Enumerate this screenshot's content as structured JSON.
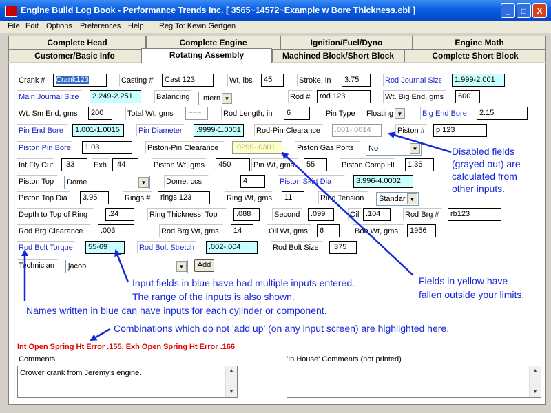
{
  "window": {
    "title": "Engine Build Log Book - Performance Trends Inc.   [ 3565~14572~Example w Bore Thickness.ebl ]",
    "buttons": {
      "minimize": "_",
      "maximize": "□",
      "close": "X"
    }
  },
  "menu": {
    "items": [
      "File",
      "Edit",
      "Options",
      "Preferences",
      "Help"
    ],
    "reg_to": "Reg To: Kevin Gertgen"
  },
  "tabs": {
    "row1": [
      "Complete Head",
      "Complete Engine",
      "Ignition/Fuel/Dyno",
      "Engine Math"
    ],
    "row2": [
      "Customer/Basic Info",
      "Rotating Assembly",
      "Machined Block/Short Block",
      "Complete Short Block"
    ]
  },
  "fields": {
    "crank_no": {
      "label": "Crank #",
      "value": "Crank123"
    },
    "casting_no": {
      "label": "Casting #",
      "value": "Cast 123"
    },
    "wt_lbs": {
      "label": "Wt, lbs",
      "value": "45"
    },
    "stroke": {
      "label": "Stroke, in",
      "value": "3.75"
    },
    "rod_journal": {
      "label": "Rod Journal Size",
      "value": "1.999-2.001"
    },
    "main_journal": {
      "label": "Main Journal Size",
      "value": "2.249-2.251"
    },
    "balancing": {
      "label": "Balancing",
      "value": "Intern"
    },
    "rod_no": {
      "label": "Rod #",
      "value": "rod 123"
    },
    "wt_big_end": {
      "label": "Wt. Big End, gms",
      "value": "600"
    },
    "wt_sm_end": {
      "label": "Wt. Sm End, gms",
      "value": "200"
    },
    "total_wt": {
      "label": "Total Wt, gms",
      "value": "~~~"
    },
    "rod_length": {
      "label": "Rod Length, in",
      "value": "6"
    },
    "pin_type": {
      "label": "Pin Type",
      "value": "Floating"
    },
    "big_end_bore": {
      "label": "Big End Bore",
      "value": "2.15"
    },
    "pin_end_bore": {
      "label": "Pin End Bore",
      "value": "1.001-1.0015"
    },
    "pin_diameter": {
      "label": "Pin Diameter",
      "value": ".9999-1.0001"
    },
    "rod_pin_clear": {
      "label": "Rod-Pin Clearance",
      "value": ".001-.0014"
    },
    "piston_no": {
      "label": "Piston #",
      "value": "p 123"
    },
    "piston_pin_bore": {
      "label": "Piston Pin Bore",
      "value": "1.03"
    },
    "piston_pin_clear": {
      "label": "Piston-Pin Clearance",
      "value": ".0299-.0301"
    },
    "piston_gas_ports": {
      "label": "Piston Gas Ports",
      "value": "No"
    },
    "int_fly_cut": {
      "label": "Int Fly Cut",
      "value": ".33"
    },
    "exh": {
      "label": "Exh",
      "value": ".44"
    },
    "piston_wt": {
      "label": "Piston Wt, gms",
      "value": "450"
    },
    "pin_wt": {
      "label": "Pin Wt, gms",
      "value": "55"
    },
    "piston_comp_ht": {
      "label": "Piston Comp Ht",
      "value": "1.36"
    },
    "piston_top": {
      "label": "Piston Top",
      "value": "Dome"
    },
    "dome_ccs": {
      "label": "Dome, ccs",
      "value": "4"
    },
    "piston_skirt_dia": {
      "label": "Piston Skirt Dia",
      "value": "3.996-4.0002"
    },
    "piston_top_dia": {
      "label": "Piston Top Dia",
      "value": "3.95"
    },
    "rings_no": {
      "label": "Rings #",
      "value": "rings 123"
    },
    "ring_wt": {
      "label": "Ring Wt, gms",
      "value": "11"
    },
    "ring_tension": {
      "label": "Ring Tension",
      "value": "Standar"
    },
    "depth_top_ring": {
      "label": "Depth to Top of Ring",
      "value": ".24"
    },
    "ring_thick_top": {
      "label": "Ring Thickness, Top",
      "value": ".088"
    },
    "second": {
      "label": "Second",
      "value": ".099"
    },
    "oil": {
      "label": "Oil",
      "value": ".104"
    },
    "rod_brg_no": {
      "label": "Rod Brg #",
      "value": "rb123"
    },
    "rod_brg_clear": {
      "label": "Rod Brg Clearance",
      "value": ".003"
    },
    "rod_brg_wt": {
      "label": "Rod Brg Wt, gms",
      "value": "14"
    },
    "oil_wt": {
      "label": "Oil Wt, gms",
      "value": "6"
    },
    "bob_wt": {
      "label": "Bob Wt, gms",
      "value": "1956"
    },
    "rod_bolt_torque": {
      "label": "Rod Bolt Torque",
      "value": "55-69"
    },
    "rod_bolt_stretch": {
      "label": "Rod Bolt Stretch",
      "value": ".002-.004"
    },
    "rod_bolt_size": {
      "label": "Rod Bolt Size",
      "value": ".375"
    },
    "technician": {
      "label": "Technician",
      "value": "jacob"
    }
  },
  "add_button": "Add",
  "error_text": "Int Open Spring Ht Error .155, Exh Open Spring Ht Error .166",
  "comments": {
    "label": "Comments",
    "value": "Crower crank from Jeremy's engine."
  },
  "inhouse_comments": {
    "label": "'In House' Comments (not printed)",
    "value": ""
  },
  "annotations": {
    "disabled": [
      "Disabled fields",
      "(grayed out) are",
      "calculated from",
      "other inputs."
    ],
    "yellow": [
      "Fields in yellow have",
      "fallen outside your limits."
    ],
    "blue_inputs": [
      "Input fields in blue have had multiple inputs entered.",
      "The range of the inputs is also shown."
    ],
    "blue_names": "Names written in blue can have inputs for each cylinder or component.",
    "combinations": "Combinations which do not 'add up' (on any input screen) are highlighted here."
  },
  "colors": {
    "annotation": "#1428d8",
    "cyan_field": "#c8ffff",
    "yellow_field": "#ffffcc",
    "error": "#e00000",
    "blue_label": "#1c28c8"
  }
}
